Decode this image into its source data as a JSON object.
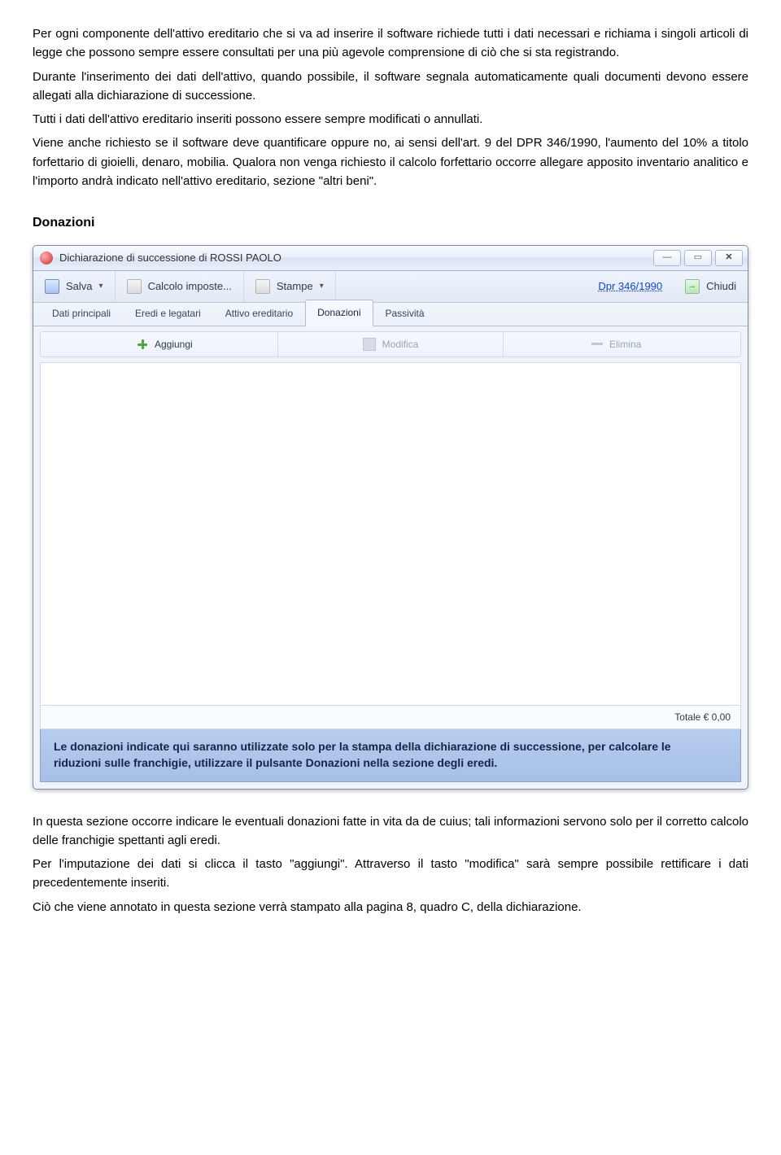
{
  "doc": {
    "p1": "Per ogni componente dell'attivo ereditario che si va ad inserire il software richiede tutti i dati necessari e richiama i singoli articoli di legge che possono sempre essere consultati per una più agevole comprensione di ciò che si sta registrando.",
    "p2": "Durante l'inserimento dei dati dell'attivo, quando possibile, il software segnala automaticamente quali documenti devono essere allegati alla dichiarazione di successione.",
    "p3": "Tutti i dati dell'attivo ereditario inseriti possono essere sempre modificati o annullati.",
    "p4": "Viene anche richiesto se il software deve quantificare oppure no, ai sensi dell'art. 9 del DPR 346/1990, l'aumento del 10% a titolo forfettario di gioielli, denaro, mobilia. Qualora non venga richiesto il calcolo forfettario occorre allegare apposito inventario analitico e l'importo andrà indicato nell'attivo ereditario, sezione \"altri beni\".",
    "heading_donazioni": "Donazioni",
    "p5": "In questa sezione occorre indicare le eventuali donazioni fatte in vita da de cuius; tali informazioni servono solo per il corretto calcolo delle franchigie spettanti agli eredi.",
    "p6": "Per l'imputazione dei dati si clicca il tasto \"aggiungi\". Attraverso il tasto \"modifica\" sarà sempre possibile rettificare i dati precedentemente inseriti.",
    "p7": "Ciò che viene annotato in questa sezione verrà stampato alla pagina 8, quadro C, della dichiarazione."
  },
  "window": {
    "title": "Dichiarazione di successione di ROSSI PAOLO",
    "controls": {
      "min": "—",
      "max": "▭",
      "close": "✕"
    },
    "toolbar": {
      "salva": "Salva",
      "calcolo": "Calcolo imposte...",
      "stampe": "Stampe",
      "dpr": "Dpr 346/1990",
      "chiudi": "Chiudi"
    },
    "tabs": {
      "dati": "Dati principali",
      "eredi": "Eredi e legatari",
      "attivo": "Attivo ereditario",
      "donazioni": "Donazioni",
      "passivita": "Passività"
    },
    "subtoolbar": {
      "aggiungi": "Aggiungi",
      "modifica": "Modifica",
      "elimina": "Elimina"
    },
    "totale": "Totale € 0,00",
    "info": "Le donazioni indicate qui saranno utilizzate solo per la stampa della dichiarazione di successione, per calcolare le riduzioni sulle franchigie, utilizzare il pulsante Donazioni nella sezione degli eredi."
  }
}
